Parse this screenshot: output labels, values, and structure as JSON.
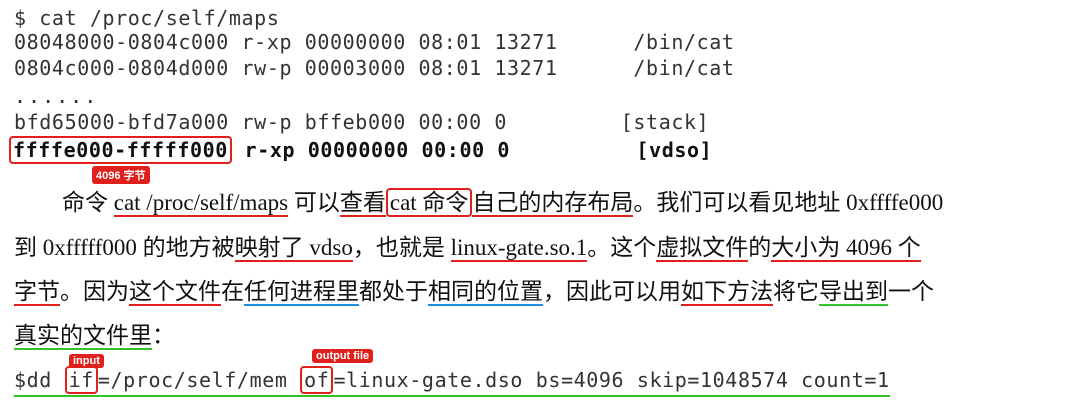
{
  "terminal": {
    "command": "$ cat /proc/self/maps",
    "line1": "08048000-0804c000 r-xp 00000000 08:01 13271      /bin/cat",
    "line2": "0804c000-0804d000 rw-p 00003000 08:01 13271      /bin/cat",
    "ellipsis": "......",
    "line3": "bfd65000-bfd7a000 rw-p bffeb000 00:00 0         [stack]",
    "vdso_range": "ffffe000-fffff000",
    "vdso_rest": " r-xp 00000000 00:00 0          [vdso]"
  },
  "annotations": {
    "size_tag": "4096 字节",
    "input_tag": "input",
    "output_tag": "output file"
  },
  "paragraph": {
    "l1_a": "命令 ",
    "l1_b": "cat /proc/self/maps",
    "l1_c": " 可以",
    "l1_d": "查看",
    "l1_e": "cat 命令",
    "l1_f": "自己的",
    "l1_g": "内存布局",
    "l1_h": "。我们可以看见地址 0xffffe000",
    "l2_a": "到 0xfffff000 的地方被",
    "l2_b": "映射了 vdso",
    "l2_c": "，也就是 ",
    "l2_d": "linux-gate.so.1",
    "l2_e": "。这个",
    "l2_f": "虚拟文件",
    "l2_g": "的",
    "l2_h": "大小为 4096 个",
    "l3_a": "字节",
    "l3_b": "。因为",
    "l3_c": "这个文件",
    "l3_d": "在",
    "l3_e": "任何进程里",
    "l3_f": "都处于",
    "l3_g": "相同的位置",
    "l3_h": "，因此可以用",
    "l3_i": "如下方法",
    "l3_j": "将它",
    "l3_k": "导出到",
    "l3_l": "一个",
    "l4_a": "真实的文件里",
    "l4_b": "："
  },
  "dd": {
    "prefix": "$dd ",
    "if_kw": "if",
    "mid": "=/proc/self/mem ",
    "of_kw": "of",
    "rest": "=linux-gate.dso bs=4096 skip=1048574 count=1"
  }
}
